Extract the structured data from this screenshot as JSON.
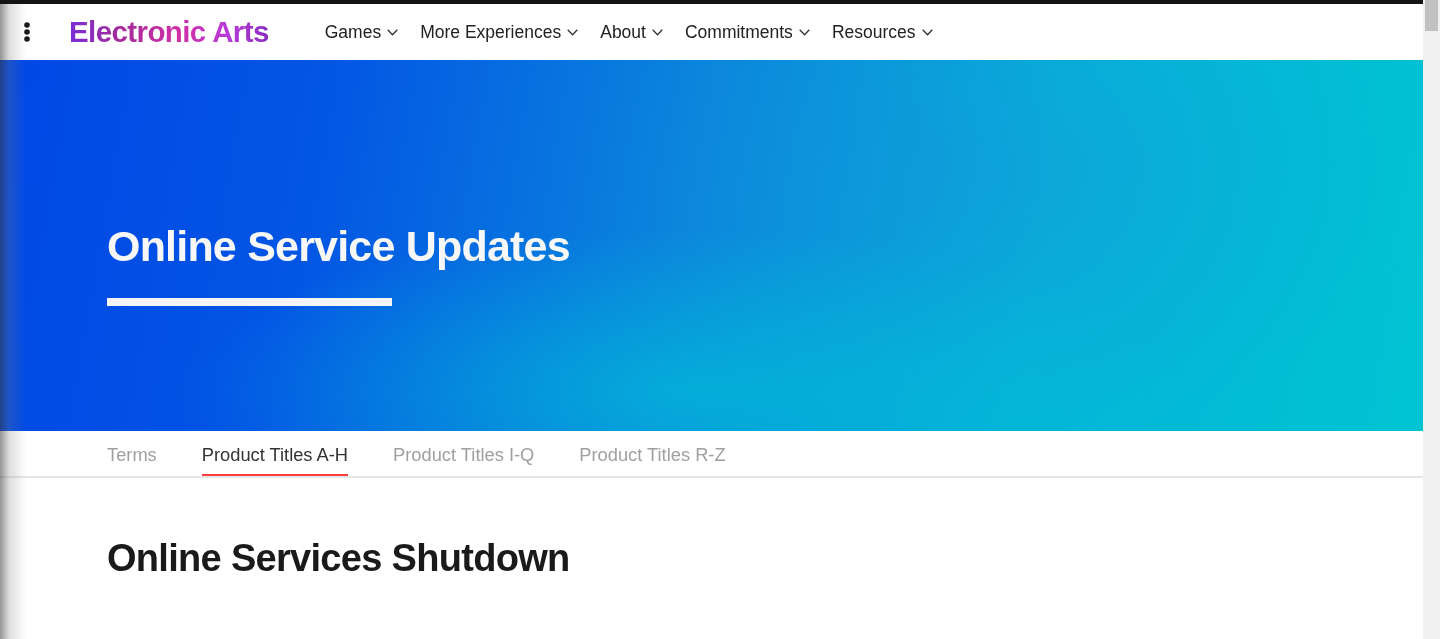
{
  "nav": {
    "logo": "Electronic Arts",
    "items": [
      {
        "label": "Games"
      },
      {
        "label": "More Experiences"
      },
      {
        "label": "About"
      },
      {
        "label": "Commitments"
      },
      {
        "label": "Resources"
      }
    ]
  },
  "hero": {
    "title": "Online Service Updates"
  },
  "tabs": [
    {
      "label": "Terms",
      "selected": false
    },
    {
      "label": "Product Titles A-H",
      "selected": true
    },
    {
      "label": "Product Titles I-Q",
      "selected": false
    },
    {
      "label": "Product Titles R-Z",
      "selected": false
    }
  ],
  "section": {
    "heading": "Online Services Shutdown"
  }
}
